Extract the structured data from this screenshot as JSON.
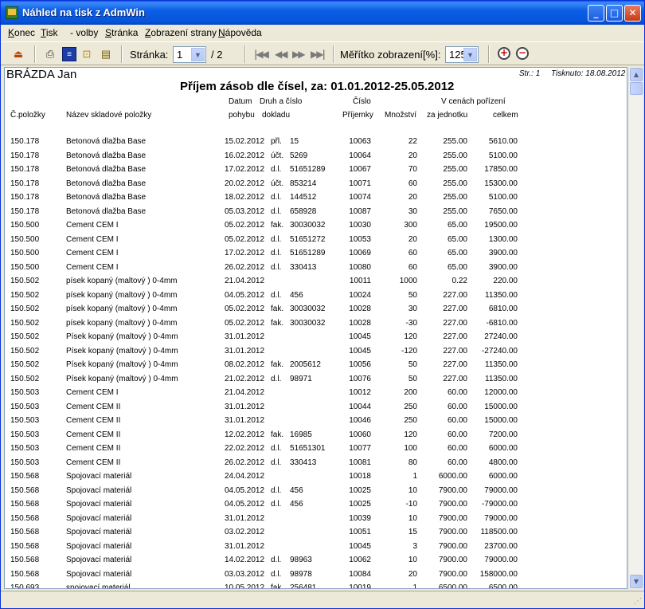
{
  "window": {
    "title": "Náhled na tisk z AdmWin"
  },
  "menu": [
    {
      "accel": "K",
      "rest": "onec"
    },
    {
      "accel": "T",
      "rest": "isk"
    },
    {
      "accel": "",
      "rest": "- volby"
    },
    {
      "accel": "S",
      "rest": "tránka"
    },
    {
      "accel": "Z",
      "rest": "obrazení strany"
    },
    {
      "accel": "N",
      "rest": "ápověda"
    }
  ],
  "toolbar": {
    "page_label": "Stránka:",
    "page_value": "1",
    "page_total": "/ 2",
    "scale_label": "Měřítko zobrazení[%]:",
    "scale_value": "125"
  },
  "report": {
    "author": "BRÁZDA Jan",
    "page_info": "Str.: 1",
    "printed": "Tisknuto: 18.08.2012",
    "title": "Příjem zásob dle čísel, za: 01.01.2012-25.05.2012",
    "headers": {
      "code": "Č.položky",
      "name": "Název skladové položky",
      "date_top": "Datum",
      "date_bottom": "pohybu",
      "doc_top": "Druh a číslo",
      "doc_bottom": "dokladu",
      "recnum_top": "Číslo",
      "recnum_bottom": "Příjemky",
      "qty": "Množství",
      "prices_top": "V cenách pořízení",
      "unit": "za jednotku",
      "total": "celkem"
    },
    "rows": [
      [
        "150.178",
        "Betonová dlažba Base",
        "15.02.2012",
        "přl.",
        "15",
        "10063",
        "22",
        "255.00",
        "5610.00"
      ],
      [
        "150.178",
        "Betonová dlažba Base",
        "16.02.2012",
        "účt.",
        "5269",
        "10064",
        "20",
        "255.00",
        "5100.00"
      ],
      [
        "150.178",
        "Betonová dlažba Base",
        "17.02.2012",
        "d.l.",
        "51651289",
        "10067",
        "70",
        "255.00",
        "17850.00"
      ],
      [
        "150.178",
        "Betonová dlažba Base",
        "20.02.2012",
        "účt.",
        "853214",
        "10071",
        "60",
        "255.00",
        "15300.00"
      ],
      [
        "150.178",
        "Betonová dlažba Base",
        "18.02.2012",
        "d.l.",
        "144512",
        "10074",
        "20",
        "255.00",
        "5100.00"
      ],
      [
        "150.178",
        "Betonová dlažba Base",
        "05.03.2012",
        "d.l.",
        "658928",
        "10087",
        "30",
        "255.00",
        "7650.00"
      ],
      [
        "150.500",
        "Cement CEM I",
        "05.02.2012",
        "fak.",
        "30030032",
        "10030",
        "300",
        "65.00",
        "19500.00"
      ],
      [
        "150.500",
        "Cement CEM I",
        "05.02.2012",
        "d.l.",
        "51651272",
        "10053",
        "20",
        "65.00",
        "1300.00"
      ],
      [
        "150.500",
        "Cement CEM I",
        "17.02.2012",
        "d.l.",
        "51651289",
        "10069",
        "60",
        "65.00",
        "3900.00"
      ],
      [
        "150.500",
        "Cement CEM I",
        "26.02.2012",
        "d.l.",
        "330413",
        "10080",
        "60",
        "65.00",
        "3900.00"
      ],
      [
        "150.502",
        "písek kopaný (maltový ) 0-4mm",
        "21.04.2012",
        "",
        "",
        "10011",
        "1000",
        "0.22",
        "220.00"
      ],
      [
        "150.502",
        "písek kopaný (maltový ) 0-4mm",
        "04.05.2012",
        "d.l.",
        "456",
        "10024",
        "50",
        "227.00",
        "11350.00"
      ],
      [
        "150.502",
        "písek kopaný (maltový ) 0-4mm",
        "05.02.2012",
        "fak.",
        "30030032",
        "10028",
        "30",
        "227.00",
        "6810.00"
      ],
      [
        "150.502",
        "písek kopaný (maltový ) 0-4mm",
        "05.02.2012",
        "fak.",
        "30030032",
        "10028",
        "-30",
        "227.00",
        "-6810.00"
      ],
      [
        "150.502",
        "Písek kopaný (maltový ) 0-4mm",
        "31.01.2012",
        "",
        "",
        "10045",
        "120",
        "227.00",
        "27240.00"
      ],
      [
        "150.502",
        "Písek kopaný (maltový ) 0-4mm",
        "31.01.2012",
        "",
        "",
        "10045",
        "-120",
        "227.00",
        "-27240.00"
      ],
      [
        "150.502",
        "Písek kopaný (maltový ) 0-4mm",
        "08.02.2012",
        "fak.",
        "2005612",
        "10056",
        "50",
        "227.00",
        "11350.00"
      ],
      [
        "150.502",
        "Písek kopaný (maltový ) 0-4mm",
        "21.02.2012",
        "d.l.",
        "98971",
        "10076",
        "50",
        "227.00",
        "11350.00"
      ],
      [
        "150.503",
        "Cement CEM I",
        "21.04.2012",
        "",
        "",
        "10012",
        "200",
        "60.00",
        "12000.00"
      ],
      [
        "150.503",
        "Cement CEM II",
        "31.01.2012",
        "",
        "",
        "10044",
        "250",
        "60.00",
        "15000.00"
      ],
      [
        "150.503",
        "Cement CEM II",
        "31.01.2012",
        "",
        "",
        "10046",
        "250",
        "60.00",
        "15000.00"
      ],
      [
        "150.503",
        "Cement CEM II",
        "12.02.2012",
        "fak.",
        "16985",
        "10060",
        "120",
        "60.00",
        "7200.00"
      ],
      [
        "150.503",
        "Cement CEM II",
        "22.02.2012",
        "d.l.",
        "51651301",
        "10077",
        "100",
        "60.00",
        "6000.00"
      ],
      [
        "150.503",
        "Cement CEM II",
        "26.02.2012",
        "d.l.",
        "330413",
        "10081",
        "80",
        "60.00",
        "4800.00"
      ],
      [
        "150.568",
        "Spojovací materiál",
        "24.04.2012",
        "",
        "",
        "10018",
        "1",
        "6000.00",
        "6000.00"
      ],
      [
        "150.568",
        "Spojovací materiál",
        "04.05.2012",
        "d.l.",
        "456",
        "10025",
        "10",
        "7900.00",
        "79000.00"
      ],
      [
        "150.568",
        "Spojovací materiál",
        "04.05.2012",
        "d.l.",
        "456",
        "10025",
        "-10",
        "7900.00",
        "-79000.00"
      ],
      [
        "150.568",
        "Spojovací materiál",
        "31.01.2012",
        "",
        "",
        "10039",
        "10",
        "7900.00",
        "79000.00"
      ],
      [
        "150.568",
        "Spojovací materiál",
        "03.02.2012",
        "",
        "",
        "10051",
        "15",
        "7900.00",
        "118500.00"
      ],
      [
        "150.568",
        "Spojovací materiál",
        "31.01.2012",
        "",
        "",
        "10045",
        "3",
        "7900.00",
        "23700.00"
      ],
      [
        "150.568",
        "Spojovací materiál",
        "14.02.2012",
        "d.l.",
        "98963",
        "10062",
        "10",
        "7900.00",
        "79000.00"
      ],
      [
        "150.568",
        "Spojovací materiál",
        "03.03.2012",
        "d.l.",
        "98978",
        "10084",
        "20",
        "7900.00",
        "158000.00"
      ],
      [
        "150.693",
        "spojovací materiál",
        "10.05.2012",
        "fak.",
        "256481",
        "10019",
        "1",
        "6500.00",
        "6500.00"
      ]
    ]
  }
}
